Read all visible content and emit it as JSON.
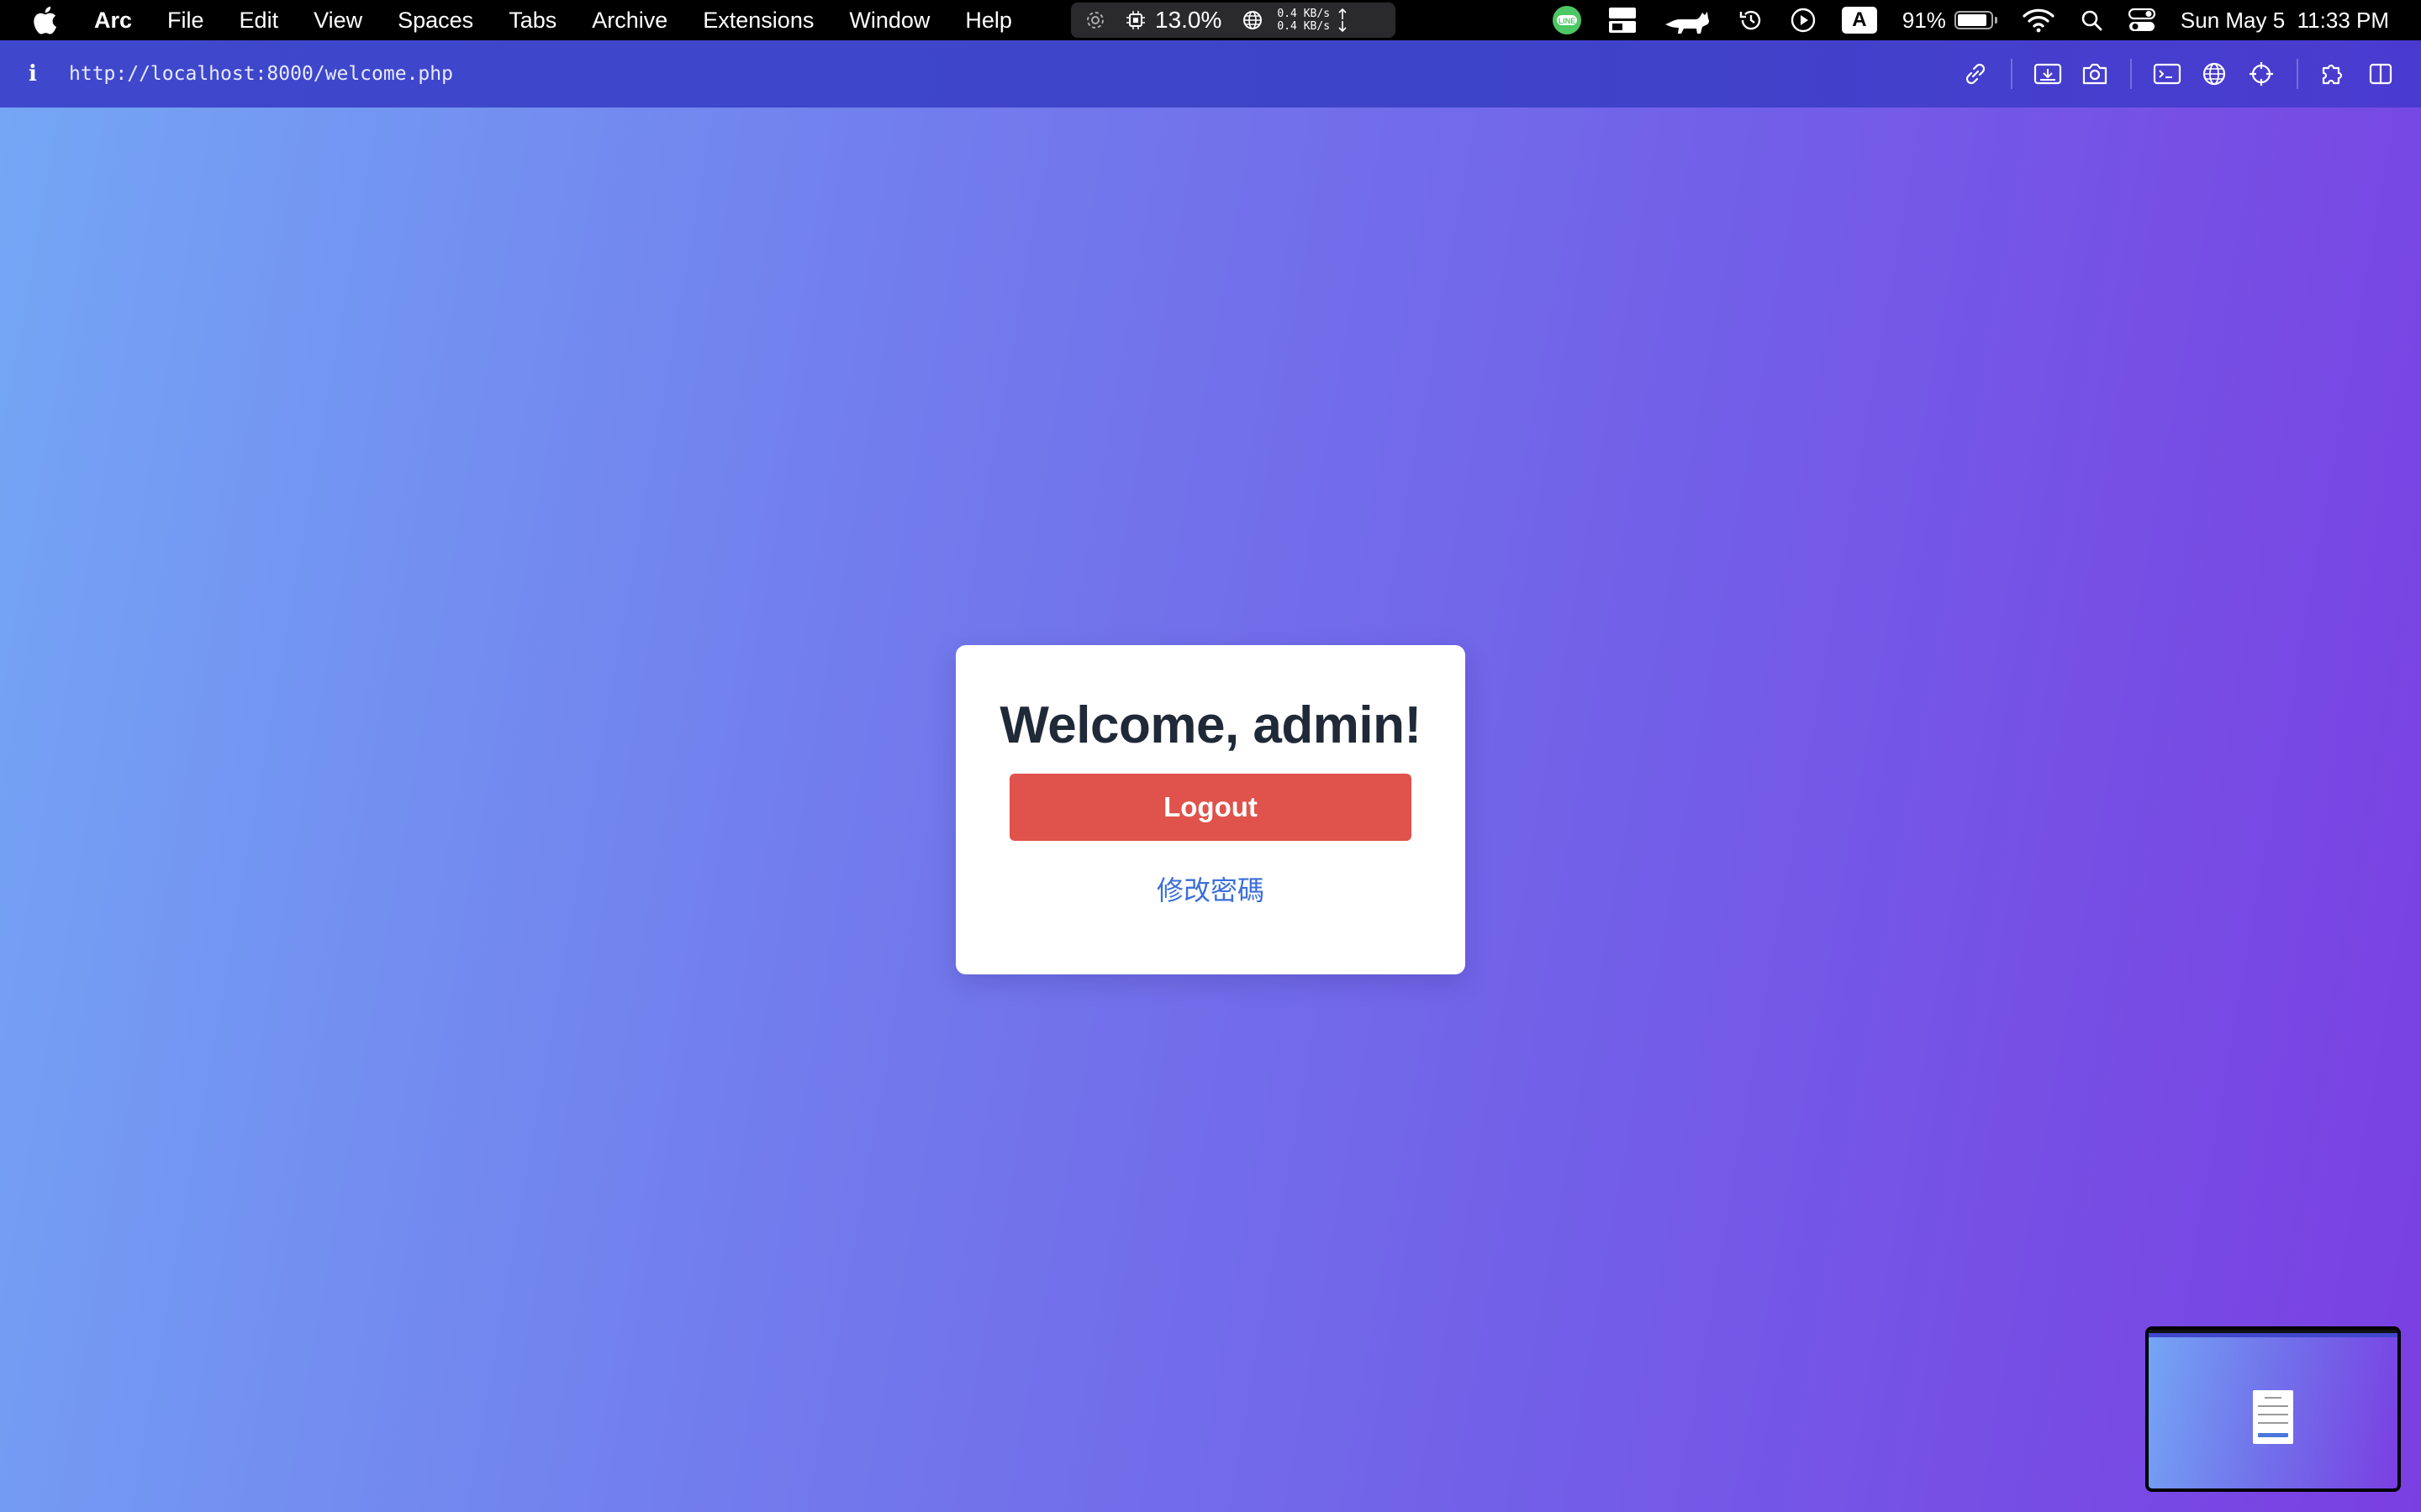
{
  "menubar": {
    "app_name": "Arc",
    "menus": [
      "File",
      "Edit",
      "View",
      "Spaces",
      "Tabs",
      "Archive",
      "Extensions",
      "Window",
      "Help"
    ],
    "stats": {
      "cpu": "13.0%",
      "net_up": "0.4 KB/s",
      "net_down": "0.4 KB/s"
    },
    "battery_percent": "91%",
    "battery_level": 0.91,
    "datetime": "Sun May 5  11:33 PM",
    "status_icons": [
      "line-icon",
      "window-icon",
      "cat-icon",
      "history-icon",
      "play-icon",
      "input-source-icon",
      "wifi-icon",
      "spotlight-icon",
      "control-center-icon"
    ]
  },
  "browser": {
    "url": "http://localhost:8000/welcome.php",
    "toolbar_icons": [
      "link-icon",
      "capture-icon",
      "camera-icon",
      "console-icon",
      "globe-icon",
      "target-icon",
      "extensions-icon",
      "split-view-icon"
    ]
  },
  "page": {
    "heading": "Welcome, admin!",
    "logout_label": "Logout",
    "change_password_label": "修改密碼"
  },
  "colors": {
    "logout_button": "#e0524c",
    "link": "#3b6fd8",
    "heading": "#1f2937"
  }
}
